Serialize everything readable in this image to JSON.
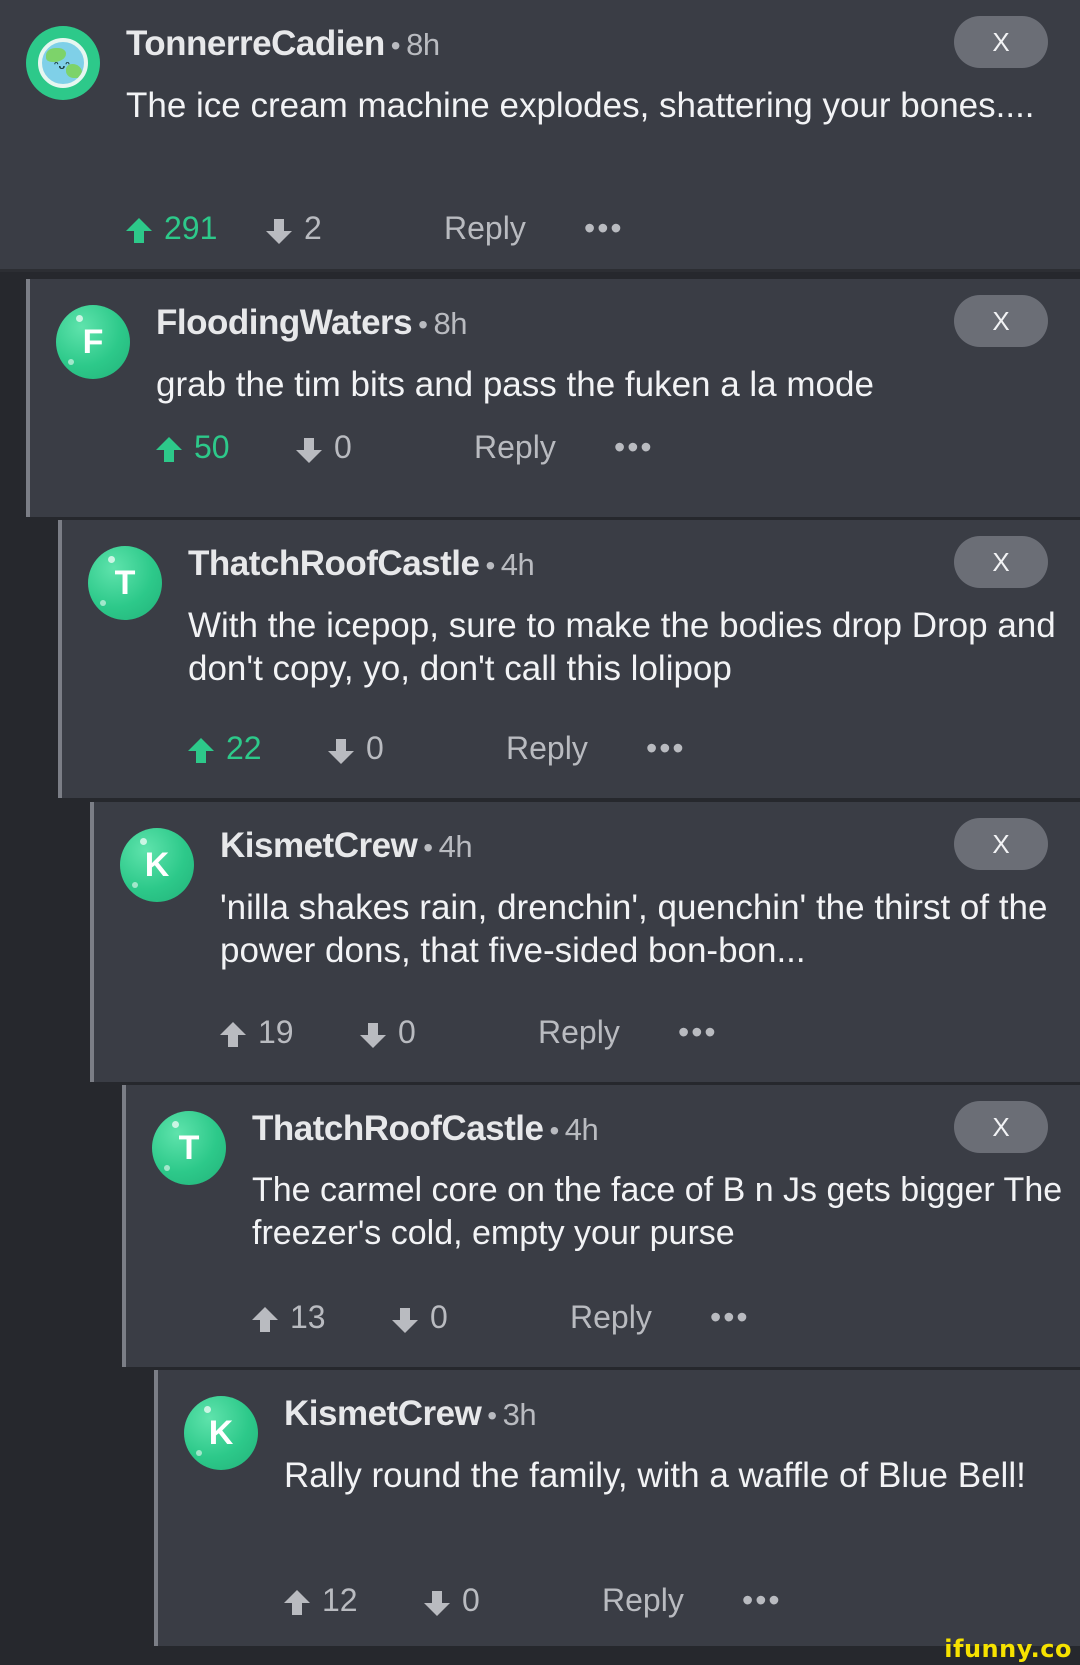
{
  "colors": {
    "upvoted": "#2dc98a",
    "panel": "#3a3d45",
    "background": "#26282d"
  },
  "comments": [
    {
      "author": "TonnerreCadien",
      "sep": "•",
      "time": "8h",
      "text": "The ice cream machine explodes, shattering your bones....",
      "up": "291",
      "down": "2",
      "reply": "Reply",
      "more": "•••",
      "close": "X",
      "avatar": "earth-avatar",
      "upvoted": true
    },
    {
      "author": "FloodingWaters",
      "sep": "•",
      "time": "8h",
      "text": "grab the tim bits and pass the fuken a la mode",
      "up": "50",
      "down": "0",
      "reply": "Reply",
      "more": "•••",
      "close": "X",
      "avatar": "F",
      "upvoted": true
    },
    {
      "author": "ThatchRoofCastle",
      "sep": "•",
      "time": "4h",
      "text": "With the icepop, sure to make the bodies drop Drop and don't copy, yo, don't call this lolipop",
      "up": "22",
      "down": "0",
      "reply": "Reply",
      "more": "•••",
      "close": "X",
      "avatar": "T",
      "upvoted": true
    },
    {
      "author": "KismetCrew",
      "sep": "•",
      "time": "4h",
      "text": "'nilla shakes rain, drenchin', quenchin' the thirst of the power dons, that five-sided bon-bon...",
      "up": "19",
      "down": "0",
      "reply": "Reply",
      "more": "•••",
      "close": "X",
      "avatar": "K",
      "upvoted": false
    },
    {
      "author": "ThatchRoofCastle",
      "sep": "•",
      "time": "4h",
      "text": "The carmel core on the face of B n Js gets bigger The freezer's cold, empty your purse",
      "up": "13",
      "down": "0",
      "reply": "Reply",
      "more": "•••",
      "close": "X",
      "avatar": "T",
      "upvoted": false
    },
    {
      "author": "KismetCrew",
      "sep": "•",
      "time": "3h",
      "text": "Rally round the family, with a waffle of Blue Bell!",
      "up": "12",
      "down": "0",
      "reply": "Reply",
      "more": "•••",
      "avatar": "K",
      "upvoted": false
    }
  ],
  "watermark": "ifunny.co"
}
